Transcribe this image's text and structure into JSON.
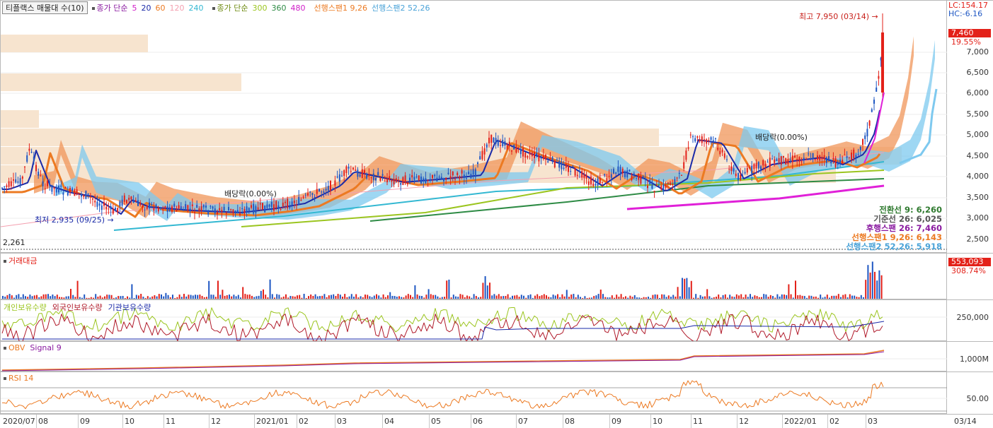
{
  "legend": {
    "stock": "티플랙스 매물대 수(10)",
    "ma_short_label": "종가 단순",
    "ma_short": [
      {
        "v": "5",
        "color": "#d01ec8"
      },
      {
        "v": "20",
        "color": "#1a2aa8"
      },
      {
        "v": "60",
        "color": "#ec7a22"
      },
      {
        "v": "120",
        "color": "#f4a0b0"
      },
      {
        "v": "240",
        "color": "#33b8d2"
      }
    ],
    "ma_long_label": "종가 단순",
    "ma_long": [
      {
        "v": "300",
        "color": "#9bc51f"
      },
      {
        "v": "360",
        "color": "#2e8b45"
      },
      {
        "v": "480",
        "color": "#d01ec8"
      }
    ],
    "lead1": "선행스팬1 9,26",
    "lead2": "선행스팬2 52,26"
  },
  "price_axis": {
    "lc": "LC:154.17",
    "hc": "HC:-6.16",
    "current": "7,460",
    "current_pct": "19.55%",
    "ticks": [
      "7,000",
      "6,500",
      "6,000",
      "5,500",
      "5,000",
      "4,500",
      "4,000",
      "3,500",
      "3,000",
      "2,500"
    ]
  },
  "annotations": {
    "high": "최고 7,950 (03/14)",
    "low": "최저 2,935 (09/25)",
    "div1": "배당락(0.00%)",
    "div2": "배당락(0.00%)",
    "min_label": "2,261"
  },
  "ichimoku": [
    {
      "label": "전환선 9: 6,260",
      "color": "#2f7a2f"
    },
    {
      "label": "기준선 26: 6,025",
      "color": "#555555"
    },
    {
      "label": "후행스팬 26: 7,460",
      "color": "#8a1aa0"
    },
    {
      "label": "선행스팬1 9,26: 6,143",
      "color": "#ec7a22"
    },
    {
      "label": "선행스팬2 52,26: 5,918",
      "color": "#4aa3d8"
    }
  ],
  "volume": {
    "title": "거래대금",
    "value": "553,093",
    "pct": "308.74%"
  },
  "holdings": {
    "items": [
      {
        "label": "개인보유수량",
        "color": "#9bc51f"
      },
      {
        "label": "외국인보유수량",
        "color": "#b01a2a"
      },
      {
        "label": "기관보유수량",
        "color": "#1a2aa8"
      }
    ],
    "tick": "250,000"
  },
  "obv": {
    "title": "OBV",
    "signal": "Signal 9",
    "tick": "1,000M"
  },
  "rsi": {
    "title": "RSI 14",
    "tick": "50.00"
  },
  "dates": [
    "2020/07",
    "08",
    "09",
    "10",
    "11",
    "12",
    "2021/01",
    "02",
    "03",
    "04",
    "05",
    "06",
    "07",
    "08",
    "09",
    "10",
    "11",
    "12",
    "2022/01",
    "02",
    "03",
    "03/14"
  ]
}
